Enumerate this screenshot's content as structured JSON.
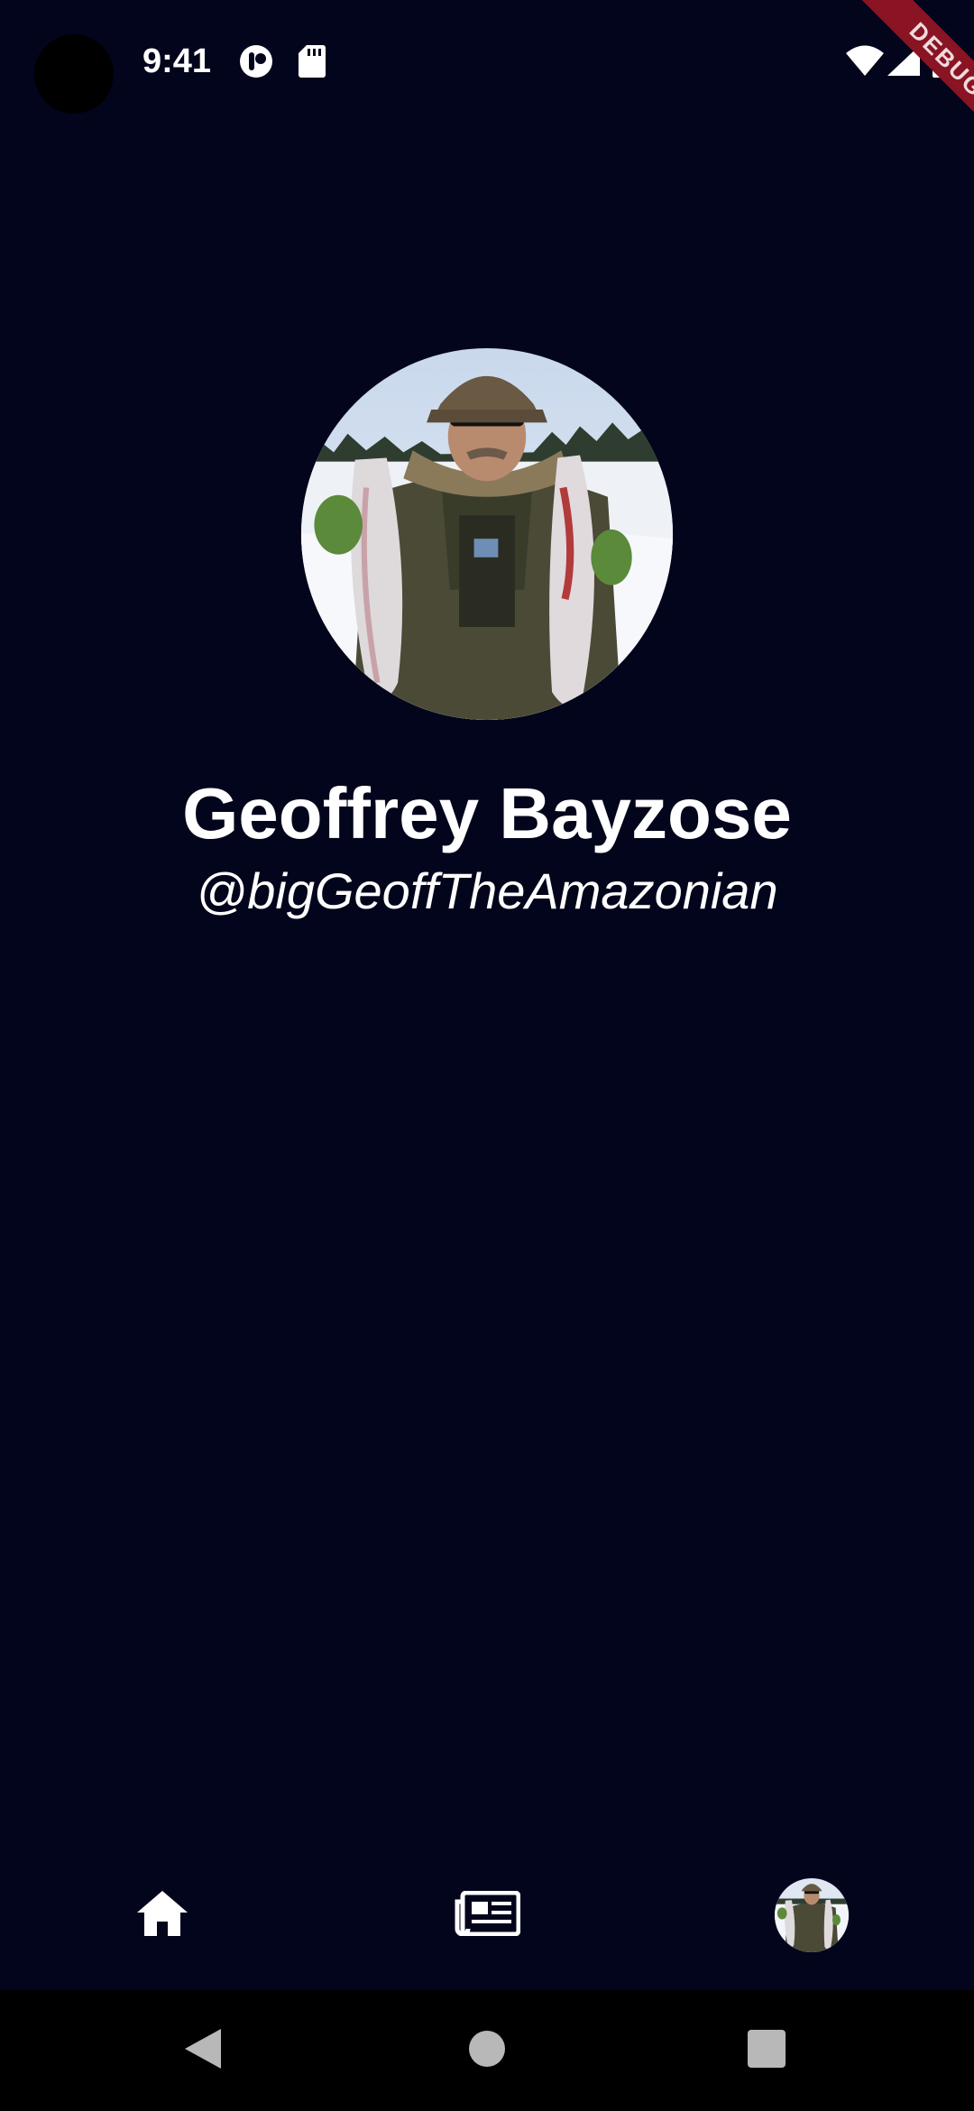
{
  "status_bar": {
    "time": "9:41",
    "debug_label": "DEBUG",
    "icons": [
      "notification-icon",
      "sd-card-icon",
      "wifi-icon",
      "signal-icon",
      "battery-icon"
    ]
  },
  "profile": {
    "name": "Geoffrey Bayzose",
    "handle": "@bigGeoffTheAmazonian",
    "avatar": "profile-photo"
  },
  "bottom_nav": {
    "items": [
      {
        "icon": "home-icon"
      },
      {
        "icon": "newspaper-icon"
      },
      {
        "icon": "profile-avatar"
      }
    ]
  },
  "system_nav": {
    "buttons": [
      "back-icon",
      "home-circle-icon",
      "recents-icon"
    ]
  },
  "colors": {
    "background": "#03051c",
    "text": "#ffffff",
    "debug_ribbon": "#8a1423",
    "system_nav": "#000000"
  }
}
